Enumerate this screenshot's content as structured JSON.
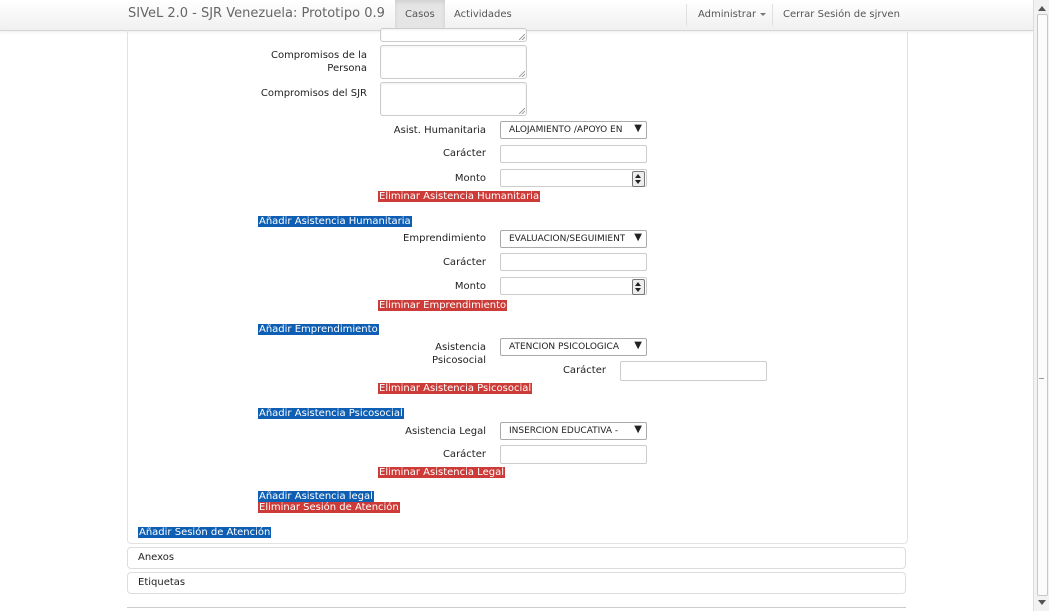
{
  "navbar": {
    "brand": "SIVeL 2.0 - SJR Venezuela: Prototipo 0.9",
    "tab_casos": "Casos",
    "tab_actividades": "Actividades",
    "administrar": "Administrar",
    "cerrar_sesion": "Cerrar Sesión de sjrven"
  },
  "form": {
    "compromisos_persona_label": "Compromisos de la Persona",
    "compromisos_sjr_label": "Compromisos del SJR",
    "humanitaria": {
      "label": "Asist. Humanitaria",
      "value": "ALOJAMIENTO /APOYO EN",
      "caracter_label": "Carácter",
      "monto_label": "Monto",
      "delete": "Eliminar Asistencia Humanitaria",
      "add": "Añadir Asistencia Humanitaria"
    },
    "emprendimiento": {
      "label": "Emprendimiento",
      "value": "EVALUACIÓN/SEGUIMIENTO",
      "caracter_label": "Carácter",
      "monto_label": "Monto",
      "delete": "Eliminar Emprendimiento",
      "add": "Añadir Emprendimiento"
    },
    "psicosocial": {
      "label": "Asistencia Psicosocial",
      "value": "ATENCIÓN PSICOLÓGICA",
      "caracter_label": "Carácter",
      "delete": "Eliminar Asistencia Psicosocial",
      "add": "Añadir Asistencia Psicosocial"
    },
    "legal": {
      "label": "Asistencia Legal",
      "value": "INSERCIÓN EDUCATIVA -",
      "caracter_label": "Carácter",
      "delete": "Eliminar Asistencia Legal",
      "add": "Añadir Asistencia legal"
    },
    "eliminar_sesion": "Eliminar Sesión de Atención",
    "anadir_sesion": "Añadir Sesión de Atención"
  },
  "accordion": {
    "anexos": "Anexos",
    "etiquetas": "Etiquetas"
  },
  "colors": {
    "add_button": "#0e5fb4",
    "delete_button": "#cc3b37"
  }
}
